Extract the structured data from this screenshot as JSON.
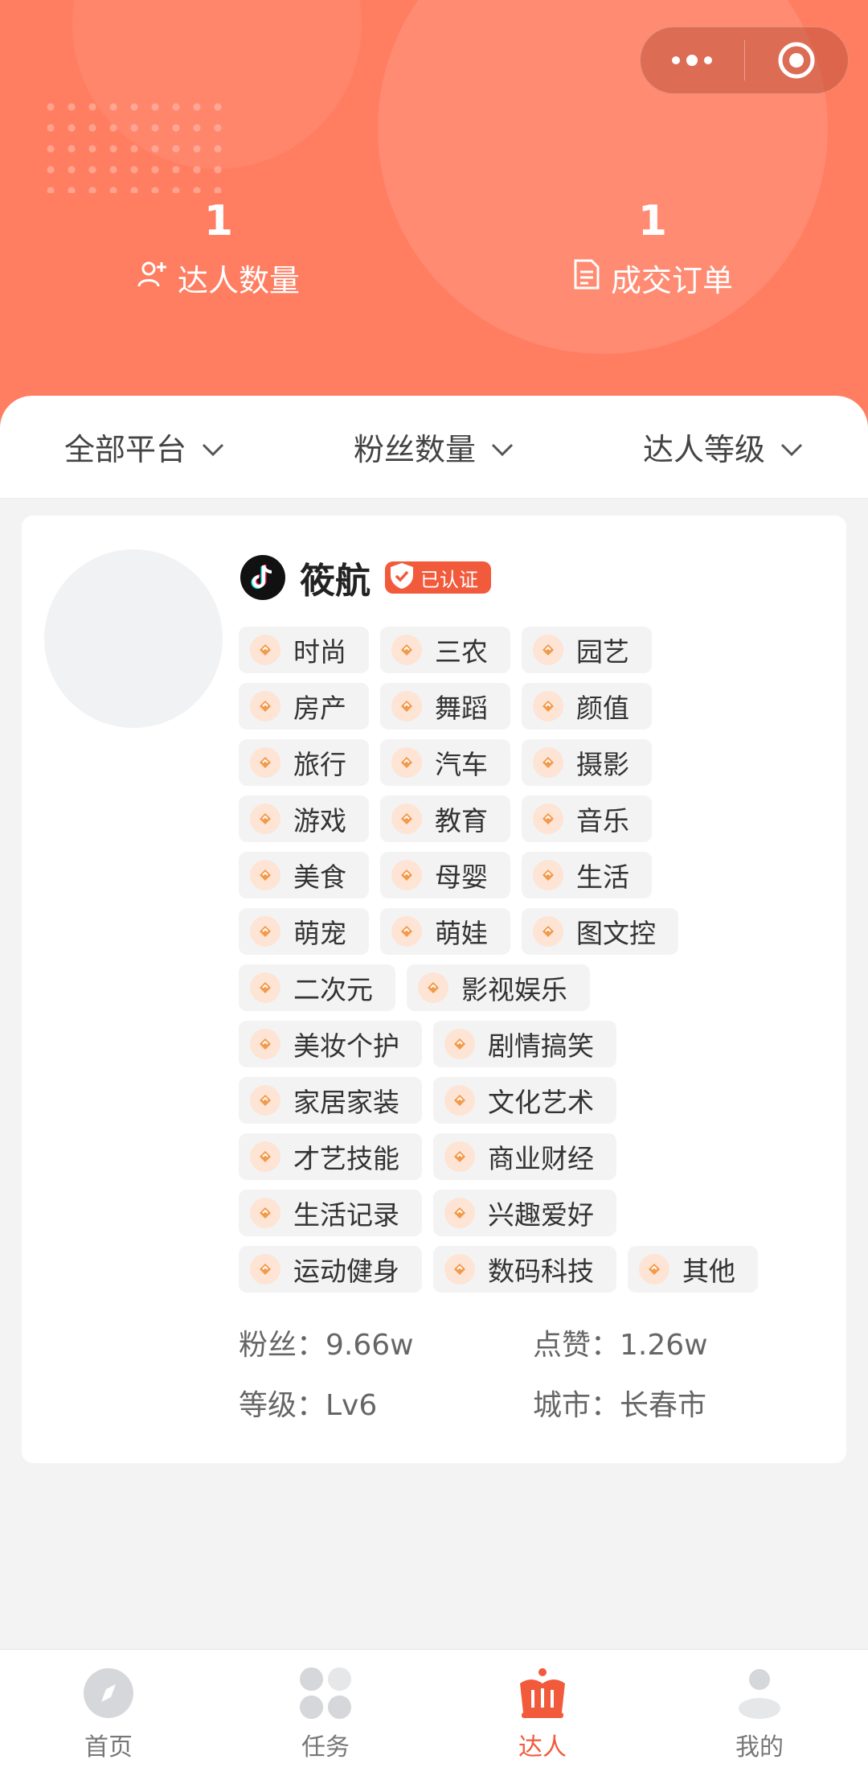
{
  "header": {
    "stats": [
      {
        "value": "1",
        "label": "达人数量",
        "icon": "add-user-icon"
      },
      {
        "value": "1",
        "label": "成交订单",
        "icon": "document-icon"
      }
    ],
    "capsule": {
      "more_icon": "more-dots-icon",
      "close_icon": "target-icon"
    }
  },
  "filters": [
    {
      "label": "全部平台"
    },
    {
      "label": "粉丝数量"
    },
    {
      "label": "达人等级"
    }
  ],
  "influencer": {
    "platform_icon": "tiktok-icon",
    "name": "筱航",
    "verified_label": "已认证",
    "tags": [
      [
        "时尚",
        "三农",
        "园艺"
      ],
      [
        "房产",
        "舞蹈",
        "颜值"
      ],
      [
        "旅行",
        "汽车",
        "摄影"
      ],
      [
        "游戏",
        "教育",
        "音乐"
      ],
      [
        "美食",
        "母婴",
        "生活"
      ],
      [
        "萌宠",
        "萌娃",
        "图文控"
      ],
      [
        "二次元",
        "影视娱乐"
      ],
      [
        "美妆个护",
        "剧情搞笑"
      ],
      [
        "家居家装",
        "文化艺术"
      ],
      [
        "才艺技能",
        "商业财经"
      ],
      [
        "生活记录",
        "兴趣爱好"
      ],
      [
        "运动健身",
        "数码科技",
        "其他"
      ]
    ],
    "fans": "粉丝：9.66w",
    "likes": "点赞：1.26w",
    "level": "等级：Lv6",
    "city": "城市：长春市"
  },
  "tabbar": [
    {
      "label": "首页",
      "icon": "compass-icon",
      "active": false
    },
    {
      "label": "任务",
      "icon": "grid-icon",
      "active": false
    },
    {
      "label": "达人",
      "icon": "crown-icon",
      "active": true
    },
    {
      "label": "我的",
      "icon": "person-icon",
      "active": false
    }
  ],
  "colors": {
    "accent": "#ff7e62",
    "active": "#f25a3c"
  }
}
